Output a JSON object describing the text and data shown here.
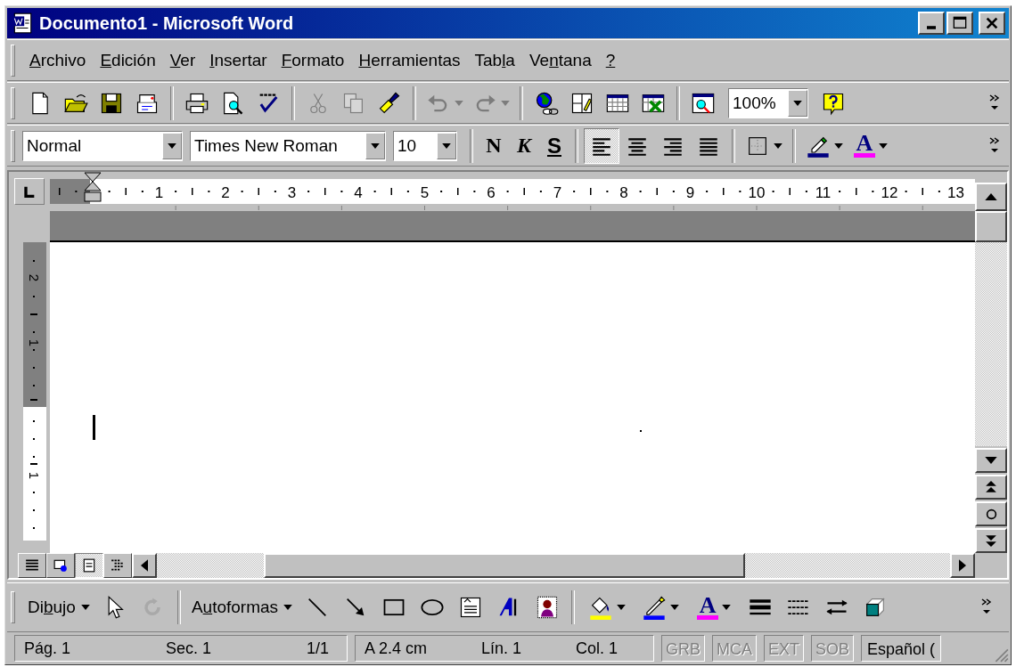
{
  "window": {
    "title": "Documento1 - Microsoft Word"
  },
  "menu": [
    {
      "parts": [
        {
          "text": "A",
          "underlined": true
        },
        {
          "text": "rchivo",
          "underlined": false
        }
      ]
    },
    {
      "parts": [
        {
          "text": "E",
          "underlined": true
        },
        {
          "text": "dición",
          "underlined": false
        }
      ]
    },
    {
      "parts": [
        {
          "text": "V",
          "underlined": true
        },
        {
          "text": "er",
          "underlined": false
        }
      ]
    },
    {
      "parts": [
        {
          "text": "I",
          "underlined": true
        },
        {
          "text": "nsertar",
          "underlined": false
        }
      ]
    },
    {
      "parts": [
        {
          "text": "F",
          "underlined": true
        },
        {
          "text": "ormato",
          "underlined": false
        }
      ]
    },
    {
      "parts": [
        {
          "text": "H",
          "underlined": true
        },
        {
          "text": "erramientas",
          "underlined": false
        }
      ]
    },
    {
      "parts": [
        {
          "text": "Tab",
          "underlined": false
        },
        {
          "text": "l",
          "underlined": true
        },
        {
          "text": "a",
          "underlined": false
        }
      ]
    },
    {
      "parts": [
        {
          "text": "Ve",
          "underlined": false
        },
        {
          "text": "n",
          "underlined": true
        },
        {
          "text": "tana",
          "underlined": false
        }
      ]
    },
    {
      "parts": [
        {
          "text": "?",
          "underlined": true
        }
      ]
    }
  ],
  "standard_toolbar": {
    "buttons": [
      {
        "disabled": false
      },
      {
        "disabled": false
      },
      {
        "disabled": false
      },
      {
        "disabled": false
      },
      {
        "disabled": false
      },
      {
        "disabled": false
      },
      {
        "disabled": false
      },
      {
        "disabled": true
      },
      {
        "disabled": true
      },
      {
        "disabled": false
      },
      {
        "disabled": true
      },
      {
        "disabled": true
      },
      {
        "disabled": false
      },
      {
        "disabled": false
      },
      {
        "disabled": false
      },
      {
        "disabled": false
      },
      {
        "disabled": false
      },
      {
        "disabled": false
      }
    ],
    "zoom": {
      "value": "100%"
    }
  },
  "formatting_toolbar": {
    "style": {
      "value": "Normal"
    },
    "font": {
      "value": "Times New Roman"
    },
    "size": {
      "value": "10"
    },
    "text_styles": [
      {
        "label": "N",
        "kind": "bold"
      },
      {
        "label": "K",
        "kind": "italic"
      },
      {
        "label": "S",
        "kind": "underline"
      }
    ],
    "alignment": [
      {
        "selected": true
      },
      {
        "selected": false
      },
      {
        "selected": false
      },
      {
        "selected": false
      }
    ],
    "font_color_glyph": "A"
  },
  "ruler": {
    "numbers": [
      "1",
      "2",
      "3",
      "4",
      "5",
      "6",
      "7",
      "8",
      "9",
      "10",
      "11",
      "12",
      "13"
    ]
  },
  "vertical_ruler": {
    "numbers": [
      "2",
      "1",
      "1"
    ]
  },
  "view_buttons": [
    {
      "selected": false
    },
    {
      "selected": false
    },
    {
      "selected": true
    },
    {
      "selected": false
    }
  ],
  "drawing_toolbar": {
    "menus": [
      {
        "parts": [
          {
            "text": "Di",
            "underlined": false
          },
          {
            "text": "b",
            "underlined": true
          },
          {
            "text": "ujo",
            "underlined": false
          }
        ]
      },
      {
        "parts": [
          {
            "text": "A",
            "underlined": false
          },
          {
            "text": "u",
            "underlined": true
          },
          {
            "text": "toformas",
            "underlined": false
          }
        ]
      }
    ],
    "buttons": [
      {
        "disabled": false
      },
      {
        "disabled": true
      },
      {
        "disabled": false
      },
      {
        "disabled": false
      },
      {
        "disabled": false
      },
      {
        "disabled": false
      },
      {
        "disabled": false
      },
      {
        "disabled": false
      },
      {
        "disabled": false
      },
      {
        "disabled": false
      },
      {
        "disabled": false
      },
      {
        "disabled": false
      },
      {
        "disabled": false
      },
      {
        "disabled": false
      },
      {
        "disabled": false
      },
      {
        "disabled": false
      }
    ],
    "font_color_glyph": "A"
  },
  "status_bar": {
    "sections": [
      {
        "fields": [
          "Pág. 1",
          "Sec. 1",
          "1/1"
        ]
      },
      {
        "fields": [
          "A 2.4 cm",
          "Lín. 1",
          "Col. 1"
        ]
      }
    ],
    "modes": [
      {
        "label": "GRB",
        "on": false
      },
      {
        "label": "MCA",
        "on": false
      },
      {
        "label": "EXT",
        "on": false
      },
      {
        "label": "SOB",
        "on": false
      }
    ],
    "language": "Español ("
  }
}
